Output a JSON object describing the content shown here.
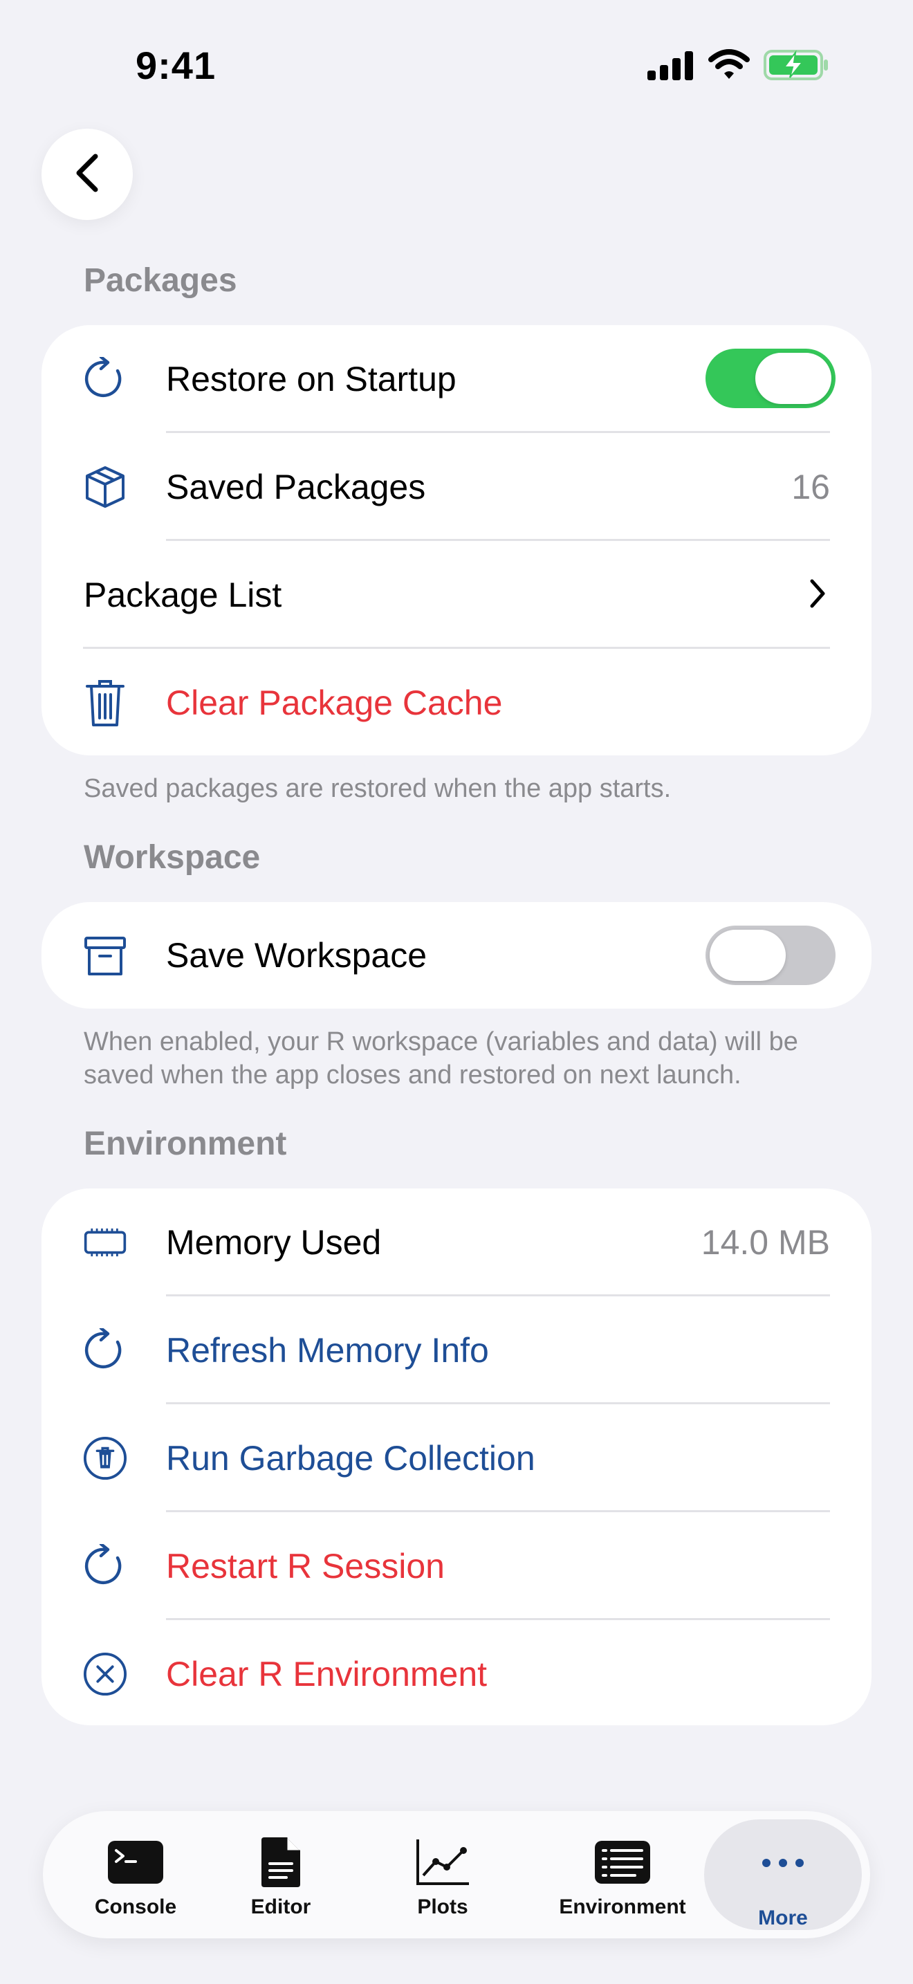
{
  "status_bar": {
    "time": "9:41"
  },
  "colors": {
    "accent_blue": "#1E4E96",
    "destructive_red": "#E8343B",
    "toggle_on": "#34C759",
    "toggle_off": "#C8C8CC",
    "secondary_text": "#8A8A8E"
  },
  "packages": {
    "header": "Packages",
    "restore_on_startup": {
      "label": "Restore on Startup",
      "icon": "refresh-icon",
      "enabled": true
    },
    "saved_packages": {
      "label": "Saved Packages",
      "icon": "package-box-icon",
      "value": "16"
    },
    "package_list": {
      "label": "Package List",
      "icon": "chevron-right-icon"
    },
    "clear_cache": {
      "label": "Clear Package Cache",
      "icon": "trash-icon"
    },
    "footnote": "Saved packages are restored when the app starts."
  },
  "workspace": {
    "header": "Workspace",
    "save_workspace": {
      "label": "Save Workspace",
      "icon": "archive-box-icon",
      "enabled": false
    },
    "footnote": "When enabled, your R workspace (variables and data) will be saved when the app closes and restored on next launch."
  },
  "environment": {
    "header": "Environment",
    "memory_used": {
      "label": "Memory Used",
      "icon": "memory-chip-icon",
      "value": "14.0 MB"
    },
    "refresh_memory": {
      "label": "Refresh Memory Info",
      "icon": "refresh-icon"
    },
    "garbage_collection": {
      "label": "Run Garbage Collection",
      "icon": "trash-circle-icon"
    },
    "restart_session": {
      "label": "Restart R Session",
      "icon": "refresh-icon"
    },
    "clear_environment": {
      "label": "Clear R Environment",
      "icon": "x-circle-icon"
    }
  },
  "tab_bar": {
    "tabs": [
      {
        "label": "Console",
        "icon": "terminal-icon"
      },
      {
        "label": "Editor",
        "icon": "document-icon"
      },
      {
        "label": "Plots",
        "icon": "line-chart-icon"
      },
      {
        "label": "Environment",
        "icon": "list-icon"
      },
      {
        "label": "More",
        "icon": "ellipsis-icon",
        "active": true
      }
    ]
  }
}
